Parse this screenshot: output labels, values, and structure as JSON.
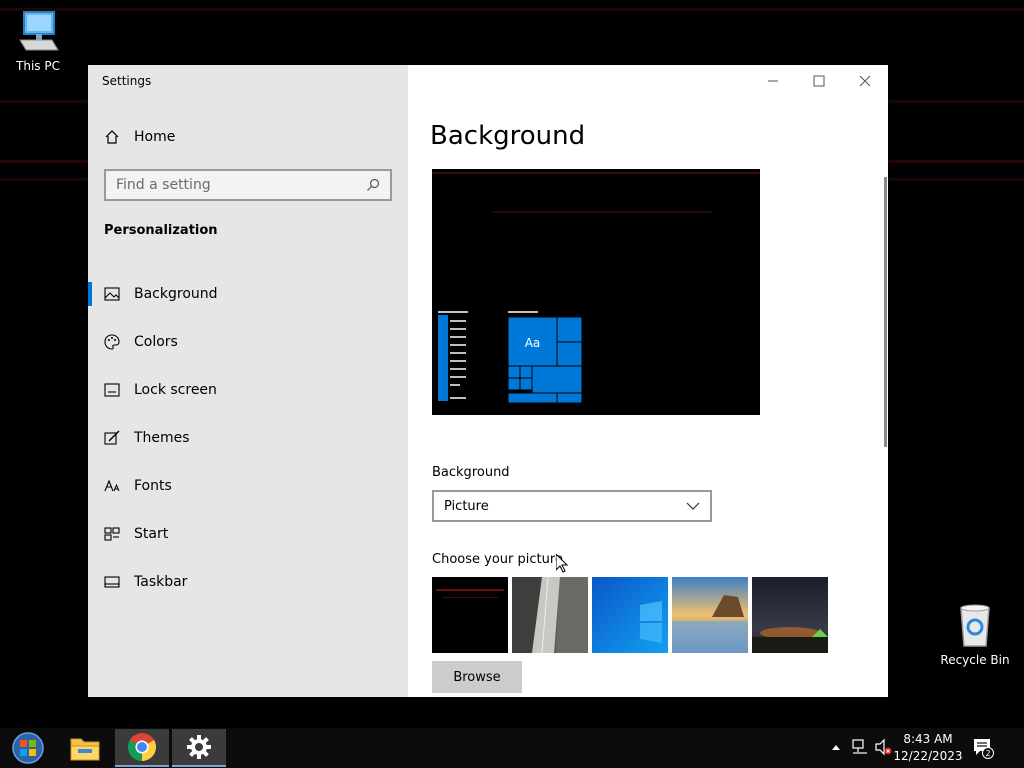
{
  "desktop": {
    "this_pc_label": "This PC",
    "recycle_bin_label": "Recycle Bin"
  },
  "window": {
    "title": "Settings"
  },
  "sidebar": {
    "home_label": "Home",
    "search_placeholder": "Find a setting",
    "section_title": "Personalization",
    "items": [
      {
        "label": "Background",
        "icon": "picture-icon",
        "active": true
      },
      {
        "label": "Colors",
        "icon": "palette-icon"
      },
      {
        "label": "Lock screen",
        "icon": "lock-screen-icon"
      },
      {
        "label": "Themes",
        "icon": "themes-icon"
      },
      {
        "label": "Fonts",
        "icon": "fonts-icon"
      },
      {
        "label": "Start",
        "icon": "start-icon"
      },
      {
        "label": "Taskbar",
        "icon": "taskbar-icon"
      }
    ]
  },
  "main": {
    "title": "Background",
    "preview_tile_text": "Aa",
    "background_label": "Background",
    "background_value": "Picture",
    "choose_picture_label": "Choose your picture",
    "browse_label": "Browse"
  },
  "taskbar": {
    "time": "8:43 AM",
    "date": "12/22/2023",
    "notification_count": "2"
  },
  "colors": {
    "accent": "#0078d7",
    "sidebar_bg": "#e6e6e6"
  }
}
